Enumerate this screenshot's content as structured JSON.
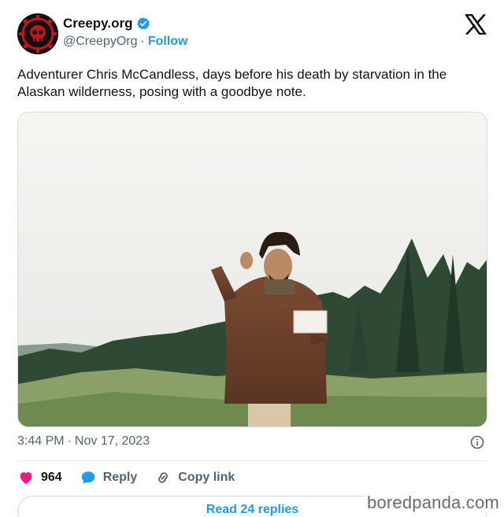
{
  "author": {
    "name": "Creepy.org",
    "handle": "@CreepyOrg",
    "separator": "·",
    "follow_label": "Follow",
    "avatar_icon": "skull-icon",
    "verified_icon": "verified-badge-icon"
  },
  "platform_icon": "x-logo-icon",
  "tweet": {
    "text": "Adventurer Chris McCandless, days before his death by starvation in the Alaskan wilderness, posing with a goodbye note.",
    "image_icon": "photo"
  },
  "meta": {
    "time": "3:44 PM",
    "separator": "·",
    "date": "Nov 17, 2023",
    "info_icon": "info-icon"
  },
  "actions": {
    "likes_count": "964",
    "reply_label": "Reply",
    "copy_link_label": "Copy link"
  },
  "replies_button": "Read 24 replies",
  "watermark": "boredpanda.com",
  "colors": {
    "accent": "#1d9bf0",
    "like": "#f91880",
    "text": "#0f1419",
    "muted": "#536471"
  }
}
